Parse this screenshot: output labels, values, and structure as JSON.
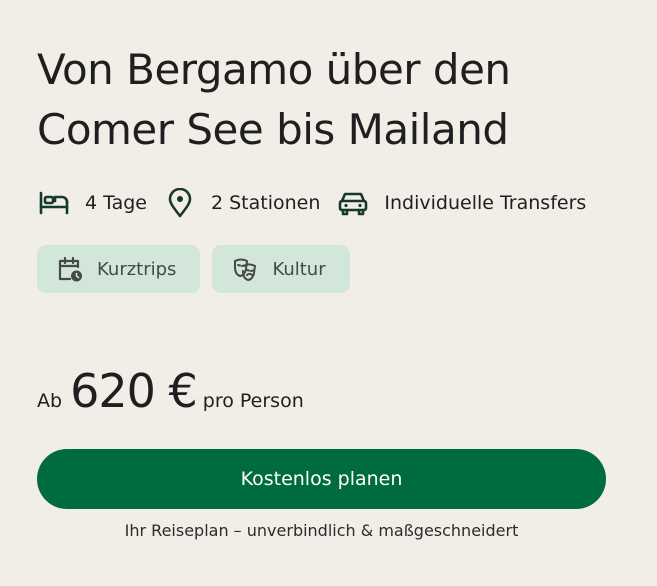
{
  "trip": {
    "title_line1": "Von Bergamo über den",
    "title_line2": "Comer See bis Mailand"
  },
  "features": [
    {
      "icon": "bed-icon",
      "label": "4 Tage"
    },
    {
      "icon": "location-pin-icon",
      "label": "2 Stationen"
    },
    {
      "icon": "car-icon",
      "label": "Individuelle Transfers"
    }
  ],
  "tags": [
    {
      "icon": "calendar-clock-icon",
      "label": "Kurztrips"
    },
    {
      "icon": "theater-masks-icon",
      "label": "Kultur"
    }
  ],
  "price": {
    "prefix": "Ab",
    "amount": "620 €",
    "suffix": "pro Person"
  },
  "cta": {
    "label": "Kostenlos planen"
  },
  "note": "Ihr Reiseplan – unverbindlich & maßgeschneidert",
  "colors": {
    "background": "#f1eee8",
    "accent": "#006b3f",
    "tag_background": "#d2e7d9",
    "text": "#1f1f1f"
  }
}
